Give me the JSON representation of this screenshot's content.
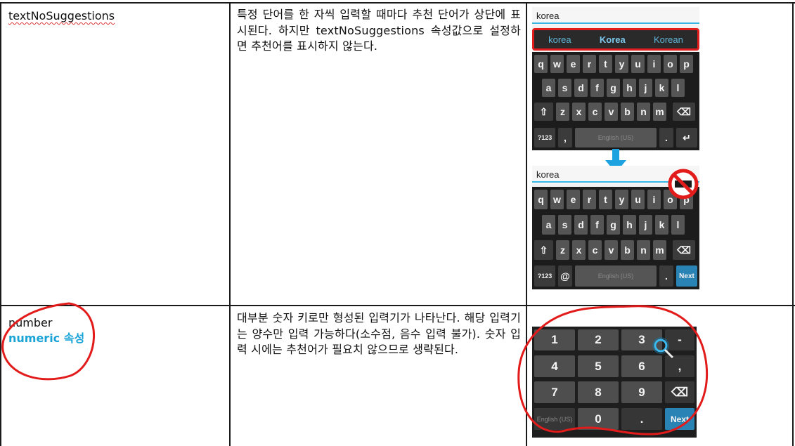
{
  "rows": [
    {
      "attribute": "textNoSuggestions",
      "description": "특정 단어를 한 자씩 입력할 때마다 추천 단어가 상단에 표시된다. 하지만 textNoSuggestions 속성값으로 설정하면 추천어를 표시하지 않는다."
    },
    {
      "attribute": "number",
      "attribute_note": "numeric 속성",
      "description": "대부분 숫자 키로만 형성된 입력기가 나타난다. 해당 입력기는 양수만 입력 가능하다(소수점, 음수 입력 불가). 숫자 입력 시에는 추천어가 필요치 않으므로 생략된다."
    }
  ],
  "keyboard_top": {
    "input_text": "korea",
    "suggestions": [
      "korea",
      "Korea",
      "Korean"
    ],
    "rows": [
      [
        "q",
        "w",
        "e",
        "r",
        "t",
        "y",
        "u",
        "i",
        "o",
        "p"
      ],
      [
        "a",
        "s",
        "d",
        "f",
        "g",
        "h",
        "j",
        "k",
        "l"
      ],
      [
        "⇧",
        "z",
        "x",
        "c",
        "v",
        "b",
        "n",
        "m",
        "⌫"
      ]
    ],
    "bottom": {
      "sym": "?123",
      "comma": ",",
      "space": "English (US)",
      "period": ".",
      "enter": "↵"
    }
  },
  "keyboard_bottom": {
    "input_text": "korea",
    "rows": [
      [
        "q",
        "w",
        "e",
        "r",
        "t",
        "y",
        "u",
        "i",
        "o",
        "p"
      ],
      [
        "a",
        "s",
        "d",
        "f",
        "g",
        "h",
        "j",
        "k",
        "l"
      ],
      [
        "⇧",
        "z",
        "x",
        "c",
        "v",
        "b",
        "n",
        "m",
        "⌫"
      ]
    ],
    "bottom": {
      "sym": "?123",
      "at": "@",
      "space": "English (US)",
      "period": ".",
      "enter": "Next"
    }
  },
  "numpad": {
    "rows": [
      [
        "1",
        "2",
        "3",
        "-"
      ],
      [
        "4",
        "5",
        "6",
        ","
      ],
      [
        "7",
        "8",
        "9",
        "⌫"
      ],
      [
        "English (US)",
        "0",
        ".",
        "Next"
      ]
    ]
  },
  "colors": {
    "accent": "#1aa3d6",
    "annotation": "#e21b1b",
    "next_key": "#2a83b5",
    "underline": "#39b5e6"
  },
  "icons": {
    "arrow": "down-arrow-icon",
    "no_suggest": "prohibited-icon"
  }
}
